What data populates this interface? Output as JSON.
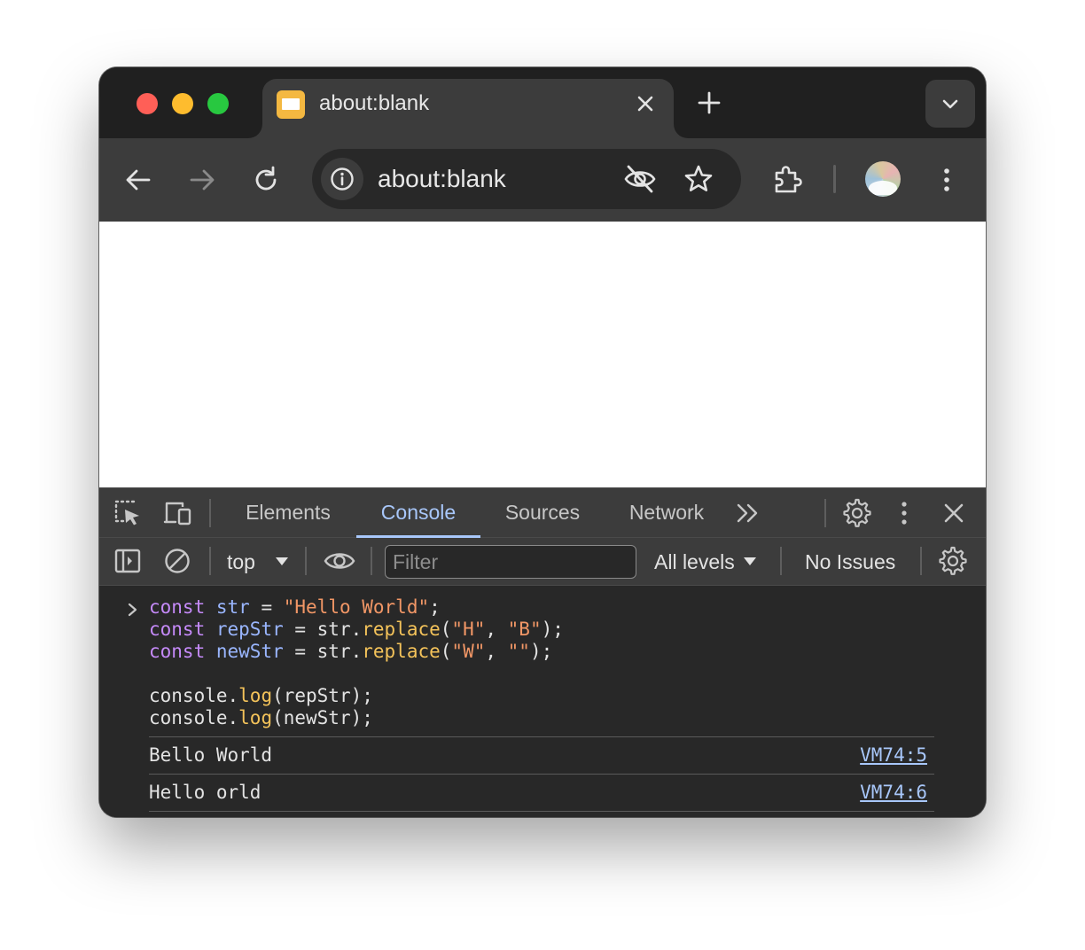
{
  "tab": {
    "title": "about:blank"
  },
  "toolbar": {
    "url": "about:blank"
  },
  "devtools": {
    "tabs": [
      {
        "label": "Elements"
      },
      {
        "label": "Console"
      },
      {
        "label": "Sources"
      },
      {
        "label": "Network"
      }
    ],
    "active_tab": "Console",
    "context": "top",
    "filter_placeholder": "Filter",
    "levels": "All levels",
    "issues": "No Issues"
  },
  "console": {
    "input_lines": [
      [
        {
          "t": "kw",
          "v": "const"
        },
        {
          "t": "p",
          "v": " "
        },
        {
          "t": "var",
          "v": "str"
        },
        {
          "t": "p",
          "v": " = "
        },
        {
          "t": "str",
          "v": "\"Hello World\""
        },
        {
          "t": "p",
          "v": ";"
        }
      ],
      [
        {
          "t": "kw",
          "v": "const"
        },
        {
          "t": "p",
          "v": " "
        },
        {
          "t": "var",
          "v": "repStr"
        },
        {
          "t": "p",
          "v": " = str."
        },
        {
          "t": "fn",
          "v": "replace"
        },
        {
          "t": "p",
          "v": "("
        },
        {
          "t": "str",
          "v": "\"H\""
        },
        {
          "t": "p",
          "v": ", "
        },
        {
          "t": "str",
          "v": "\"B\""
        },
        {
          "t": "p",
          "v": ");"
        }
      ],
      [
        {
          "t": "kw",
          "v": "const"
        },
        {
          "t": "p",
          "v": " "
        },
        {
          "t": "var",
          "v": "newStr"
        },
        {
          "t": "p",
          "v": " = str."
        },
        {
          "t": "fn",
          "v": "replace"
        },
        {
          "t": "p",
          "v": "("
        },
        {
          "t": "str",
          "v": "\"W\""
        },
        {
          "t": "p",
          "v": ", "
        },
        {
          "t": "str",
          "v": "\"\""
        },
        {
          "t": "p",
          "v": ");"
        }
      ],
      [],
      [
        {
          "t": "p",
          "v": "console."
        },
        {
          "t": "fn",
          "v": "log"
        },
        {
          "t": "p",
          "v": "(repStr);"
        }
      ],
      [
        {
          "t": "p",
          "v": "console."
        },
        {
          "t": "fn",
          "v": "log"
        },
        {
          "t": "p",
          "v": "(newStr);"
        }
      ]
    ],
    "logs": [
      {
        "text": "Bello World",
        "source": "VM74:5"
      },
      {
        "text": "Hello orld",
        "source": "VM74:6"
      }
    ]
  },
  "colors": {
    "keyword": "#c58af9",
    "variable": "#9ab6ff",
    "string": "#f29766",
    "function": "#f4c35a",
    "link": "#a8c7fa"
  }
}
